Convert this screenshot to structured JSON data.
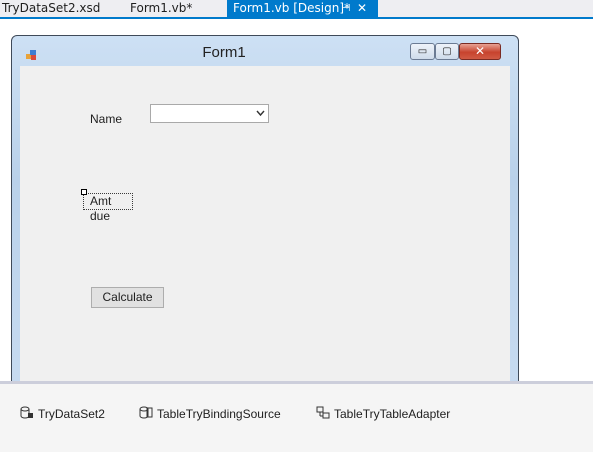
{
  "tabs": [
    {
      "label": "TryDataSet2.xsd",
      "active": false
    },
    {
      "label": "Form1.vb*",
      "active": false
    },
    {
      "label": "Form1.vb [Design]*",
      "active": true,
      "pin_glyph": "⊣",
      "close_glyph": "✕"
    }
  ],
  "form": {
    "title": "Form1",
    "icon": "form-icon",
    "caption_buttons": {
      "minimize": "▭",
      "maximize": "▢",
      "close": "✕"
    }
  },
  "controls": {
    "name_label": "Name",
    "name_combo_value": "",
    "amt_label": "Amt due",
    "calculate_button": "Calculate"
  },
  "tray": [
    {
      "label": "TryDataSet2",
      "icon": "dataset-icon"
    },
    {
      "label": "TableTryBindingSource",
      "icon": "binding-source-icon"
    },
    {
      "label": "TableTryTableAdapter",
      "icon": "table-adapter-icon"
    }
  ],
  "colors": {
    "accent": "#007acc",
    "form_client": "#f0f0f0",
    "title_bar": "#c7dbf1",
    "close_button": "#c7432e"
  }
}
